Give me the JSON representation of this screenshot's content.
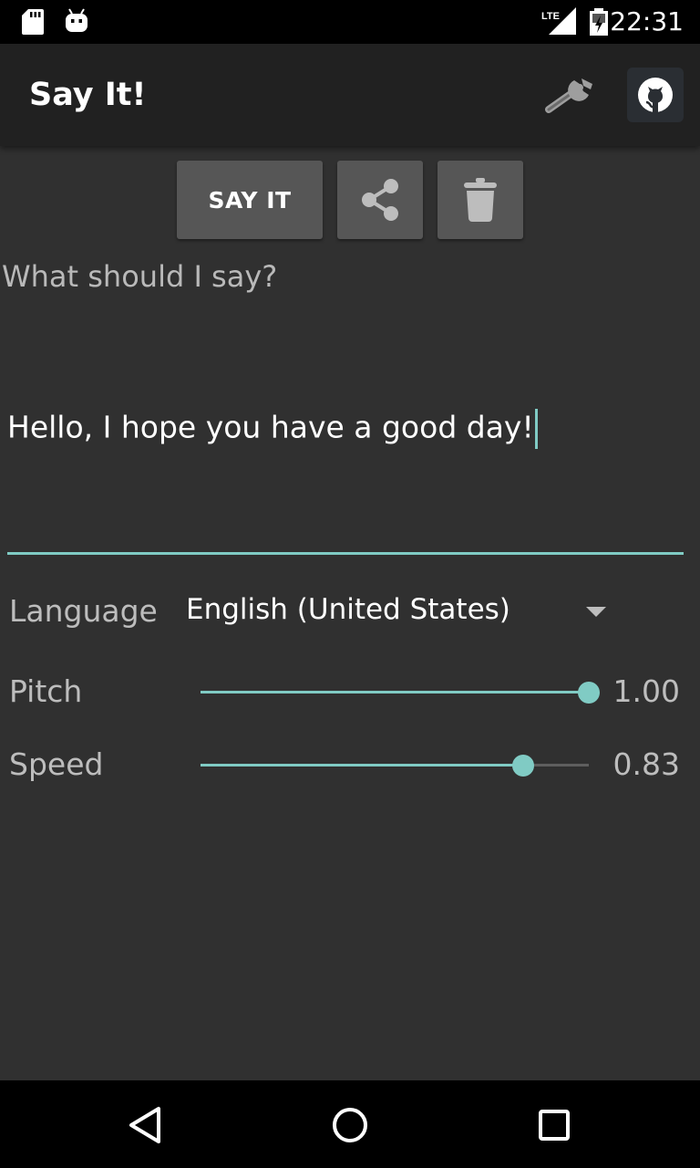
{
  "status_bar": {
    "time": "22:31",
    "network": "LTE",
    "icons": [
      "sd-card-icon",
      "android-debug-icon",
      "lte-signal-icon",
      "battery-icon"
    ]
  },
  "app_bar": {
    "title": "Say It!",
    "actions": [
      "wrench-icon",
      "github-icon"
    ]
  },
  "toolbar": {
    "say_label": "SAY IT",
    "share_icon": "share-icon",
    "delete_icon": "trash-icon"
  },
  "input": {
    "placeholder": "What should I say?",
    "value": "Hello, I hope you have a good day!"
  },
  "language": {
    "label": "Language",
    "selected": "English (United States)"
  },
  "pitch": {
    "label": "Pitch",
    "value_text": "1.00",
    "fraction": 1.0
  },
  "speed": {
    "label": "Speed",
    "value_text": "0.83",
    "fraction": 0.83
  },
  "colors": {
    "accent": "#80cbc4",
    "background": "#303030",
    "app_bar": "#212121",
    "button": "#565656"
  },
  "nav_bar": {
    "icons": [
      "back-icon",
      "home-icon",
      "recents-icon"
    ]
  }
}
